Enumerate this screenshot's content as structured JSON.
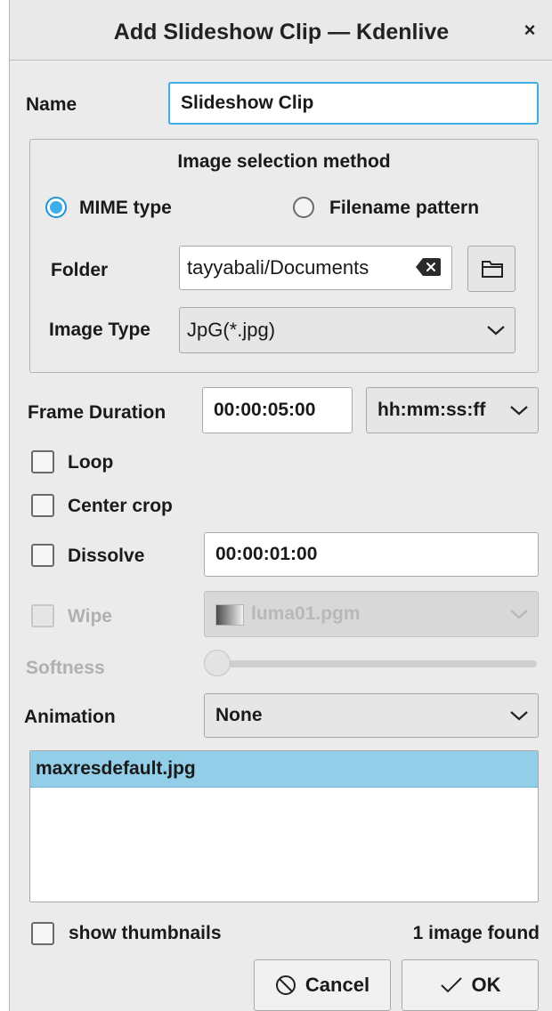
{
  "window": {
    "title": "Add Slideshow Clip — Kdenlive",
    "close_icon": "×"
  },
  "name": {
    "label": "Name",
    "value": "Slideshow Clip"
  },
  "image_selection": {
    "title": "Image selection method",
    "options": [
      {
        "label": "MIME type",
        "selected": true
      },
      {
        "label": "Filename pattern",
        "selected": false
      }
    ],
    "folder_label": "Folder",
    "folder_value": "tayyabali/Documents",
    "image_type_label": "Image Type",
    "image_type_value": "JpG(*.jpg)"
  },
  "frame_duration": {
    "label": "Frame Duration",
    "value": "00:00:05:00",
    "format": "hh:mm:ss:ff"
  },
  "options": {
    "loop_label": "Loop",
    "loop_checked": false,
    "center_crop_label": "Center crop",
    "center_crop_checked": false,
    "dissolve_label": "Dissolve",
    "dissolve_checked": false,
    "dissolve_duration": "00:00:01:00",
    "wipe_label": "Wipe",
    "wipe_checked": false,
    "wipe_value": "luma01.pgm",
    "softness_label": "Softness",
    "softness_value": 0
  },
  "animation": {
    "label": "Animation",
    "value": "None"
  },
  "file_list": {
    "items": [
      {
        "name": "maxresdefault.jpg",
        "selected": true
      }
    ]
  },
  "footer": {
    "show_thumbnails_label": "show thumbnails",
    "show_thumbnails_checked": false,
    "status": "1 image found",
    "cancel_label": "Cancel",
    "ok_label": "OK"
  },
  "colors": {
    "accent": "#3daee9",
    "selection": "#93cee9",
    "background": "#ebebeb"
  }
}
